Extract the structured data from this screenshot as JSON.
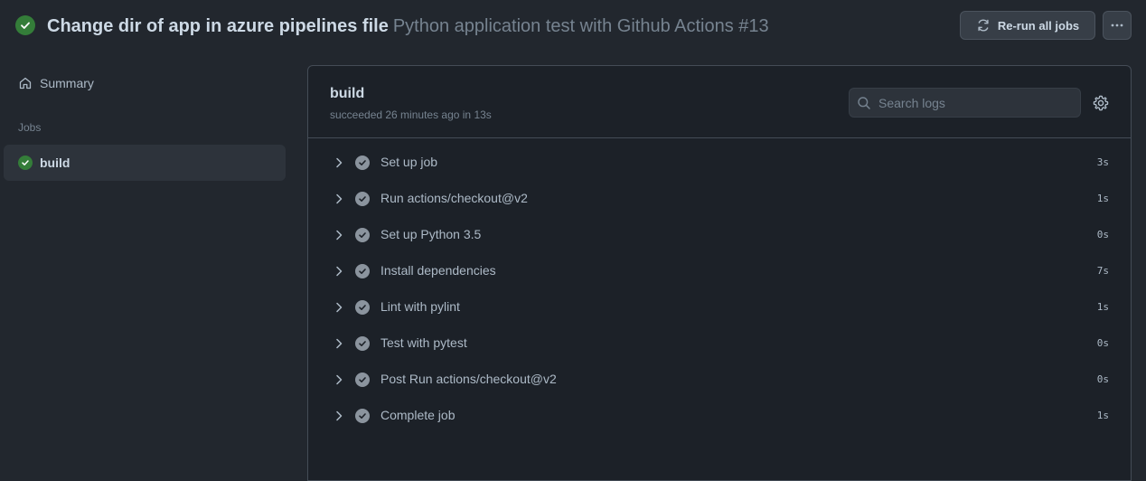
{
  "header": {
    "title": "Change dir of app in azure pipelines file",
    "workflow": "Python application test with Github Actions #13",
    "rerun_label": "Re-run all jobs",
    "status_color": "#347d39"
  },
  "sidebar": {
    "summary_label": "Summary",
    "jobs_label": "Jobs",
    "jobs": [
      {
        "label": "build",
        "status": "success"
      }
    ]
  },
  "job": {
    "name": "build",
    "meta": "succeeded 26 minutes ago in 13s",
    "search_placeholder": "Search logs",
    "steps": [
      {
        "label": "Set up job",
        "duration": "3s"
      },
      {
        "label": "Run actions/checkout@v2",
        "duration": "1s"
      },
      {
        "label": "Set up Python 3.5",
        "duration": "0s"
      },
      {
        "label": "Install dependencies",
        "duration": "7s"
      },
      {
        "label": "Lint with pylint",
        "duration": "1s"
      },
      {
        "label": "Test with pytest",
        "duration": "0s"
      },
      {
        "label": "Post Run actions/checkout@v2",
        "duration": "0s"
      },
      {
        "label": "Complete job",
        "duration": "1s"
      }
    ]
  },
  "icons": {
    "status": "check-circle-icon",
    "rerun": "sync-icon",
    "more": "kebab-horizontal-icon",
    "summary": "home-icon",
    "search": "search-icon",
    "settings": "gear-icon",
    "expand": "chevron-right-icon"
  }
}
